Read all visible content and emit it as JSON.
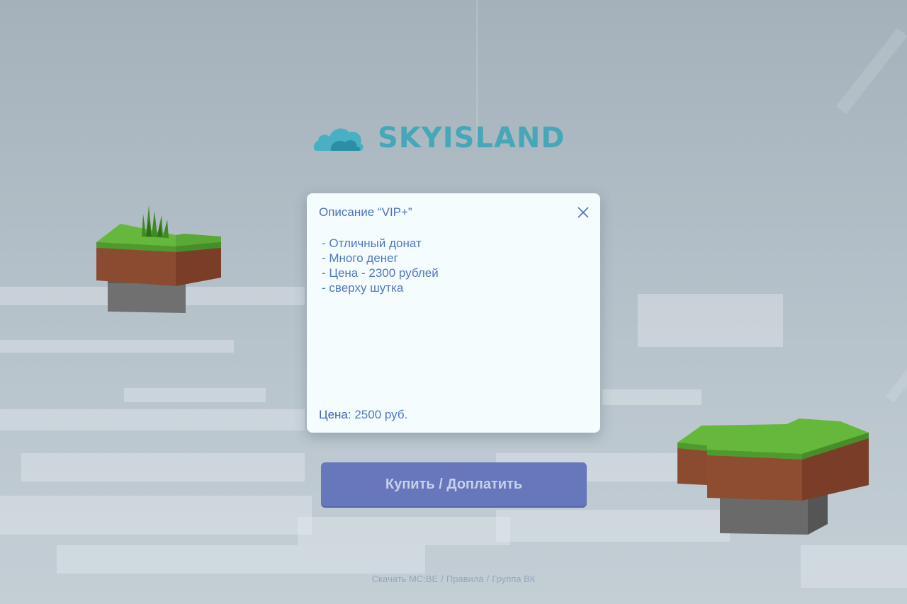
{
  "logo": {
    "text": "SKYISLAND",
    "colors": {
      "primary": "#3aa6b8",
      "dark": "#2b8fa3"
    }
  },
  "modal": {
    "title": "Описание “VIP+”",
    "close_icon": "close-icon",
    "description": [
      "- Отличный донат",
      "- Много денег",
      "- Цена - 2300 рублей",
      "- сверху шутка"
    ],
    "price_label": "Цена:",
    "price_value": "2500 руб."
  },
  "actions": {
    "buy_label": "Купить / Доплатить"
  },
  "footer": {
    "links": [
      "Скачать MC:BE",
      "Правила",
      "Группа ВК"
    ],
    "separator": "/"
  },
  "colors": {
    "accent": "#4a72bf",
    "button": "#6677bb",
    "dialog_bg": "#f5fcfd",
    "grass": "#5cb03a",
    "dirt": "#8a4a30",
    "stone": "#6e6e6e"
  }
}
